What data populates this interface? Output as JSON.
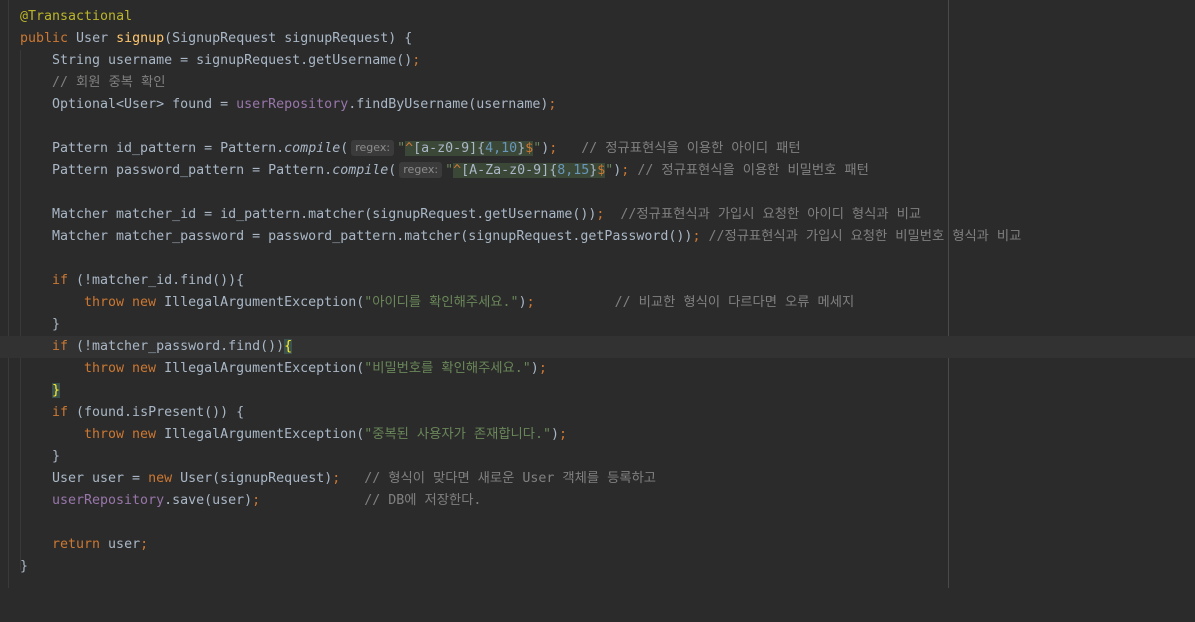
{
  "editor": {
    "language": "java",
    "colors": {
      "background": "#2b2b2b",
      "keyword": "#cc7832",
      "annotation": "#bbb529",
      "method": "#ffc66d",
      "string": "#6a8759",
      "comment": "#808080",
      "field": "#9876aa"
    },
    "lines": {
      "l1": {
        "annotation": "@Transactional"
      },
      "l2": {
        "kw": "public",
        "type": " User ",
        "method": "signup",
        "rest": "(SignupRequest signupRequest) {"
      },
      "l3": {
        "code": "String username = signupRequest.getUsername()",
        "semi": ";"
      },
      "l4": {
        "comment": "// 회원 중복 확인"
      },
      "l5": {
        "pre": "Optional<User> found = ",
        "field": "userRepository",
        "post": ".findByUsername(username)",
        "semi": ";"
      },
      "l7": {
        "pre": "Pattern id_pattern = Pattern.",
        "method": "compile",
        "open": "(",
        "hint": "regex:",
        "q1": "\"",
        "r1": "^",
        "r2": "[a-z0-9]",
        "r3": "{",
        "r4": "4,10",
        "r5": "}",
        "r6": "$",
        "q2": "\"",
        "close": ")",
        "semi": ";",
        "comment": "   // 정규표현식을 이용한 아이디 패턴"
      },
      "l8": {
        "pre": "Pattern password_pattern = Pattern.",
        "method": "compile",
        "open": "(",
        "hint": "regex:",
        "q1": "\"",
        "r1": "^",
        "r2": "[A-Za-z0-9]",
        "r3": "{",
        "r4": "8,15",
        "r5": "}",
        "r6": "$",
        "q2": "\"",
        "close": ")",
        "semi": ";",
        "comment": " // 정규표현식을 이용한 비밀번호 패턴"
      },
      "l10": {
        "code": "Matcher matcher_id = id_pattern.matcher(signupRequest.getUsername())",
        "semi": ";",
        "comment": "  //정규표현식과 가입시 요청한 아이디 형식과 비교"
      },
      "l11": {
        "code": "Matcher matcher_password = password_pattern.matcher(signupRequest.getPassword())",
        "semi": ";",
        "comment": " //정규표현식과 가입시 요청한 비밀번호 형식과 비교"
      },
      "l13": {
        "kw": "if",
        "rest": " (!matcher_id.find()){"
      },
      "l14": {
        "kw1": "throw",
        "kw2": " new",
        "pre": " IllegalArgumentException(",
        "str": "\"아이디를 확인해주세요.\"",
        "post": ")",
        "semi": ";",
        "comment": "          // 비교한 형식이 다르다면 오류 메세지"
      },
      "l15": {
        "code": "}"
      },
      "l16": {
        "kw": "if",
        "rest": " (!matcher_password.find())",
        "brace": "{"
      },
      "l17": {
        "kw1": "throw",
        "kw2": " new",
        "pre": " IllegalArgumentException(",
        "str": "\"비밀번호를 확인해주세요.\"",
        "post": ")",
        "semi": ";"
      },
      "l18": {
        "brace": "}"
      },
      "l19": {
        "kw": "if",
        "rest": " (found.isPresent()) {"
      },
      "l20": {
        "kw1": "throw",
        "kw2": " new",
        "pre": " IllegalArgumentException(",
        "str": "\"중복된 사용자가 존재합니다.\"",
        "post": ")",
        "semi": ";"
      },
      "l21": {
        "code": "}"
      },
      "l22": {
        "pre": "User user = ",
        "kw": "new",
        "post": " User(signupRequest)",
        "semi": ";",
        "comment": "   // 형식이 맞다면 새로운 User 객체를 등록하고"
      },
      "l23": {
        "field": "userRepository",
        "post": ".save(user)",
        "semi": ";",
        "comment": "             // DB에 저장한다."
      },
      "l25": {
        "kw": "return",
        "post": " user",
        "semi": ";"
      },
      "l26": {
        "code": "}"
      }
    }
  }
}
